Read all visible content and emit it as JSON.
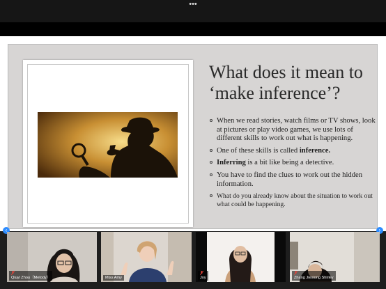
{
  "window": {
    "more_label": "•••"
  },
  "slide": {
    "title": "What does it mean to ‘make inference’?",
    "image_alt": "Silhouette of a detective with a magnifying glass and pipe",
    "bullets": [
      {
        "text": "When we read stories, watch films or TV shows, look at pictures or play video games, we use lots of different skills to work out what is happening."
      },
      {
        "before": "One of these skills is called ",
        "bold": "inference."
      },
      {
        "bold": "Inferring",
        "after": " is a bit like being a detective."
      },
      {
        "text": "You have to find the clues to work out the hidden information."
      },
      {
        "text": "What do you already know about the situation to work out what could be happening."
      }
    ]
  },
  "participants": [
    {
      "name": "Qiuyi Zhou（Melody）",
      "muted": true,
      "active": false
    },
    {
      "name": "Miss Amy",
      "muted": false,
      "active": true
    },
    {
      "name": "Joy",
      "muted": true,
      "active": false
    },
    {
      "name": "Zhang Jiexiong Shirley",
      "muted": true,
      "active": false
    }
  ],
  "gallery_nav": {
    "prev_label": "‹",
    "next_label": "›"
  },
  "colors": {
    "active_speaker": "#2fcf53",
    "muted_icon": "#e8443a",
    "nav_button": "#2d8cff"
  }
}
